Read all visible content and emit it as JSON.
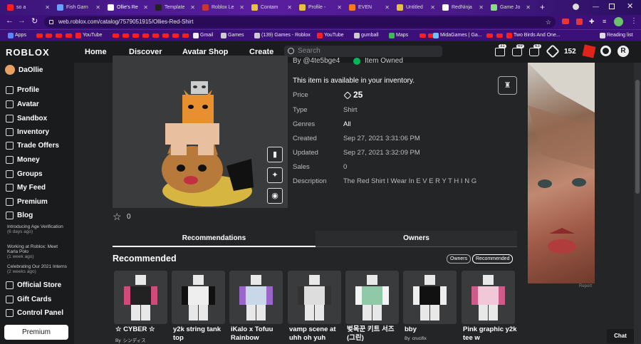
{
  "browser": {
    "tabs": [
      {
        "label": "so a",
        "color": "#ff1e1e"
      },
      {
        "label": "Fish Garn",
        "color": "#6aa0ff"
      },
      {
        "label": "Ollie's Re",
        "color": "#ffffff",
        "active": true
      },
      {
        "label": "Template",
        "color": "#222222"
      },
      {
        "label": "Roblox Le",
        "color": "#cc3333"
      },
      {
        "label": "Contam",
        "color": "#e8c040"
      },
      {
        "label": "Profile -",
        "color": "#e8c040"
      },
      {
        "label": "EVEN",
        "color": "#ff7a1a"
      },
      {
        "label": "Untitled",
        "color": "#e8c040"
      },
      {
        "label": "RedNinja",
        "color": "#ffffff"
      },
      {
        "label": "Game Jo",
        "color": "#88dd88"
      }
    ],
    "url": "web.roblox.com/catalog/7579051915/Ollies-Red-Shirt",
    "bookmarks": [
      {
        "label": "Apps"
      },
      {
        "label": "YouTube"
      },
      {
        "label": "Gmail"
      },
      {
        "label": "Games"
      },
      {
        "label": "(139) Games - Roblox"
      },
      {
        "label": "YouTube"
      },
      {
        "label": "gumball"
      },
      {
        "label": "Maps"
      },
      {
        "label": "MidaGames | Ga..."
      },
      {
        "label": "Two Birds And One..."
      },
      {
        "label": "Reading list"
      }
    ]
  },
  "topnav": {
    "logo": "ROBLOX",
    "links": [
      "Home",
      "Discover",
      "Avatar Shop",
      "Create"
    ],
    "search_placeholder": "Search",
    "badges": [
      "31",
      "69",
      "63"
    ],
    "robux": "152"
  },
  "sidebar": {
    "username": "DaOllie",
    "items": [
      "Profile",
      "Avatar",
      "Sandbox",
      "Inventory",
      "Trade Offers",
      "Money",
      "Groups",
      "My Feed",
      "Premium",
      "Blog"
    ],
    "news": [
      {
        "title": "Introducing Age Verification",
        "ago": "(6 days ago)"
      },
      {
        "title": "Working at Roblox: Meet Karla Polo",
        "ago": "(1 week ago)"
      },
      {
        "title": "Celebrating Our 2021 Interns",
        "ago": "(2 weeks ago)"
      }
    ],
    "bottom": [
      "Official Store",
      "Gift Cards",
      "Control Panel"
    ],
    "premium_button": "Premium"
  },
  "item": {
    "by": "By @4te5bge4",
    "owned": "Item Owned",
    "available": "This item is available in your inventory.",
    "fields": [
      {
        "label": "Price",
        "value": "25"
      },
      {
        "label": "Type",
        "value": "Shirt"
      },
      {
        "label": "Genres",
        "value": "All"
      },
      {
        "label": "Created",
        "value": "Sep 27, 2021 3:31:06 PM"
      },
      {
        "label": "Updated",
        "value": "Sep 27, 2021 3:32:09 PM"
      },
      {
        "label": "Sales",
        "value": "0"
      },
      {
        "label": "Description",
        "value": "The Red Shirt I Wear In E V E R Y T H I N G"
      }
    ],
    "favorites": "0"
  },
  "tabs": {
    "recommendations": "Recommendations",
    "owners": "Owners"
  },
  "recommended": {
    "title": "Recommended",
    "pills": [
      "Owners",
      "Recommended"
    ],
    "cards": [
      {
        "name": "☆ CYBER ☆",
        "by": "By",
        "creator": "シンディス",
        "shirt": "#222222",
        "accent": "#d04a7a"
      },
      {
        "name": "y2k string tank top",
        "by": "",
        "creator": "",
        "shirt": "#eeeeee",
        "accent": "#111111"
      },
      {
        "name": "iKalo x Tofuu Rainbow",
        "by": "",
        "creator": "",
        "shirt": "#c8d8e8",
        "accent": "#9a66cc"
      },
      {
        "name": "vamp scene at uhh oh yuh",
        "by": "",
        "creator": "",
        "shirt": "#dddddd",
        "accent": "#333333"
      },
      {
        "name": "벚목꾼 키트 서즈 (그린)",
        "by": "",
        "creator": "",
        "shirt": "#8fc9a8",
        "accent": "#f4f4f4"
      },
      {
        "name": "bby",
        "by": "By",
        "creator": "crucifix",
        "shirt": "#111111",
        "accent": "#eeeeee"
      },
      {
        "name": "Pink graphic y2k tee w",
        "by": "",
        "creator": "",
        "shirt": "#f0c8d8",
        "accent": "#d05a8a"
      }
    ]
  },
  "ad": {
    "report": "Report"
  },
  "chat": "Chat"
}
